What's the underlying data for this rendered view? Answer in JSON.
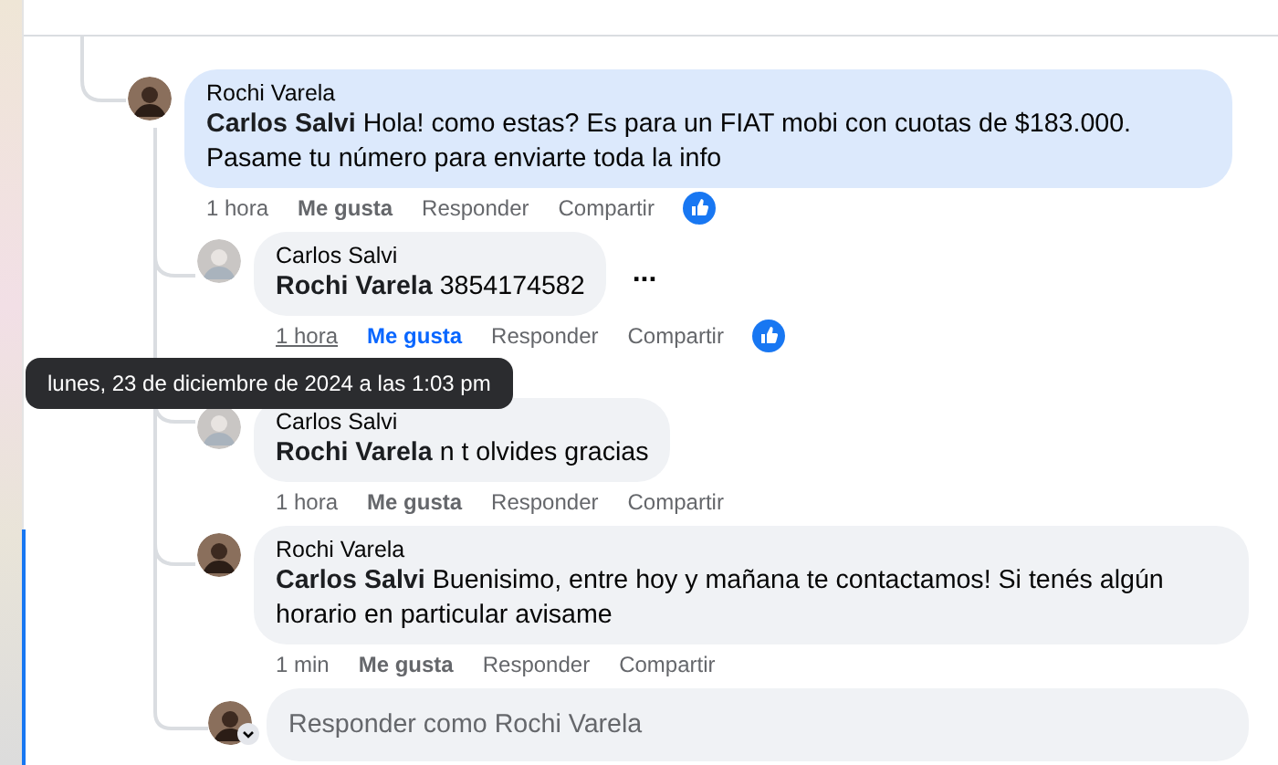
{
  "comments": [
    {
      "author": "Rochi Varela",
      "mention": "Carlos Salvi",
      "text": "Hola! como estas? Es para un FIAT mobi con cuotas de $183.000. Pasame tu número para enviarte toda la info",
      "highlighted": true,
      "nested": false,
      "menu": false,
      "actions": {
        "time": "1 hora",
        "time_hovered": false,
        "like": "Me gusta",
        "liked": false,
        "reply": "Responder",
        "share": "Compartir",
        "reaction": true
      }
    },
    {
      "author": "Carlos Salvi",
      "mention": "Rochi Varela",
      "text": "3854174582",
      "highlighted": false,
      "nested": true,
      "menu": true,
      "menu_label": "...",
      "actions": {
        "time": "1 hora",
        "time_hovered": true,
        "like": "Me gusta",
        "liked": true,
        "reply": "Responder",
        "share": "Compartir",
        "reaction": true
      }
    },
    {
      "author": "Carlos Salvi",
      "mention": "Rochi Varela",
      "text": "n t olvides gracias",
      "highlighted": false,
      "nested": true,
      "menu": false,
      "actions": {
        "time": "1 hora",
        "time_hovered": false,
        "like": "Me gusta",
        "liked": false,
        "reply": "Responder",
        "share": "Compartir",
        "reaction": false
      }
    },
    {
      "author": "Rochi Varela",
      "mention": "Carlos Salvi",
      "text": "Buenisimo, entre hoy y mañana te contactamos! Si tenés algún horario en particular avisame",
      "highlighted": false,
      "nested": true,
      "menu": false,
      "actions": {
        "time": "1 min",
        "time_hovered": false,
        "like": "Me gusta",
        "liked": false,
        "reply": "Responder",
        "share": "Compartir",
        "reaction": false
      }
    }
  ],
  "tooltip": {
    "text": "lunes, 23 de diciembre de 2024 a las 1:03 pm"
  },
  "reply_box": {
    "placeholder": "Responder como Rochi Varela"
  }
}
